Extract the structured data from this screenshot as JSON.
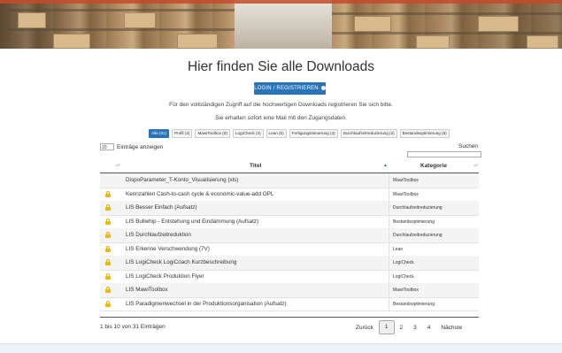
{
  "page": {
    "title": "Hier finden Sie alle Downloads",
    "login_button": "LOGIN / REGISTRIEREN",
    "info_line1": "Für den vollständigen Zugriff auf die hochwertigen Downloads registrieren Sie sich bitte.",
    "info_line2": "Sie erhalten sofort eine Mail mit den Zugangsdaten."
  },
  "filters": [
    {
      "label": "Alle (31)",
      "active": true
    },
    {
      "label": "Profil (2)",
      "active": false
    },
    {
      "label": "MawiToolbox (9)",
      "active": false
    },
    {
      "label": "LogiCheck (4)",
      "active": false
    },
    {
      "label": "Lean (5)",
      "active": false
    },
    {
      "label": "Fertigungssteuerung (4)",
      "active": false
    },
    {
      "label": "Durchlaufzeitreduzierung (2)",
      "active": false
    },
    {
      "label": "Bestandsoptimierung (5)",
      "active": false
    }
  ],
  "table_controls": {
    "length_value": "10",
    "length_suffix": "Einträge anzeigen",
    "search_label": "Suchen",
    "search_value": ""
  },
  "columns": {
    "title": "Titel",
    "category": "Kategorie"
  },
  "rows": [
    {
      "title": "DispoParameter_T-Konto_Visualisierung (xls)",
      "category": "MawiToolbox",
      "locked": false
    },
    {
      "title": "Kennzahlen Cash-to-cash cycle & economic-value-add OPL",
      "category": "MawiToolbox",
      "locked": true
    },
    {
      "title": "LIS Besser Einfach (Aufsatz)",
      "category": "Durchlaufzeitreduzierung",
      "locked": true
    },
    {
      "title": "LIS Bullwhip - Entstehung und Eindämmung (Aufsatz)",
      "category": "Bestandsoptimierung",
      "locked": true
    },
    {
      "title": "LIS Durchlaufzeitreduktion",
      "category": "Durchlaufzeitreduzierung",
      "locked": true
    },
    {
      "title": "LIS Erkenne Verschwendung (7V)",
      "category": "Lean",
      "locked": true
    },
    {
      "title": "LIS LogiCheck LogiCoach Kurzbeschreibung",
      "category": "LogiCheck",
      "locked": true
    },
    {
      "title": "LIS LogiCheck Produktion Flyer",
      "category": "LogiCheck",
      "locked": true
    },
    {
      "title": "LIS MawiToolbox",
      "category": "MawiToolbox",
      "locked": true
    },
    {
      "title": "LIS Paradigmenwechsel in der Produktionsorganisation (Aufsatz)",
      "category": "Bestandsoptimierung",
      "locked": true
    }
  ],
  "footer": {
    "info": "1 bis 10 von 31 Einträgen",
    "prev": "Zurück",
    "pages": [
      "1",
      "2",
      "3",
      "4"
    ],
    "current_page": "1",
    "next": "Nächste"
  },
  "colors": {
    "accent": "#2a73b8",
    "lock": "#f2b705"
  }
}
